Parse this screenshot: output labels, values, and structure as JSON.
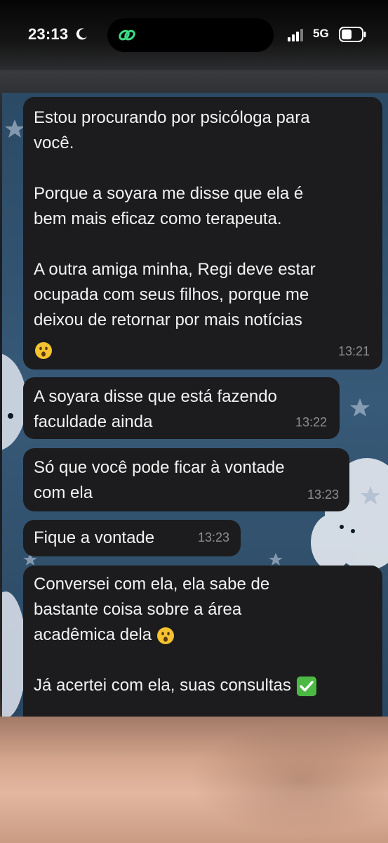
{
  "status_bar": {
    "time": "23:13",
    "network": "5G",
    "icons": [
      "moon-icon",
      "link-icon",
      "signal-icon",
      "battery-icon"
    ]
  },
  "colors": {
    "bubble_bg": "#1c1c1e",
    "bubble_text": "#f2f2f2",
    "timestamp": "#8e8e93",
    "wallpaper": "#2f4b63",
    "island_icon": "#3ddc84",
    "check_emoji": "#4cb944"
  },
  "messages": [
    {
      "paragraphs": [
        "Estou procurando por psicóloga para\nvocê.",
        "Porque a soyara me disse que ela é\nbem mais eficaz como terapeuta.",
        "A outra amiga minha, Regi deve estar\nocupada com seus filhos, porque me\ndeixou de retornar por mais notícias"
      ],
      "emoji": "astonished-face-icon",
      "time": "13:21"
    },
    {
      "text": "A soyara disse que está fazendo\nfaculdade ainda",
      "time": "13:22"
    },
    {
      "text": "Só que você pode ficar à vontade\ncom ela",
      "time": "13:23"
    },
    {
      "text": "Fique a vontade",
      "time": "13:23"
    },
    {
      "text_before_emoji": "Conversei com ela, ela sabe de\nbastante coisa sobre a área\nacadêmica dela ",
      "emoji": "astonished-face-icon",
      "text_after": "Já acertei com ela, suas consultas ",
      "emoji_end": "check-mark-button-icon"
    }
  ]
}
